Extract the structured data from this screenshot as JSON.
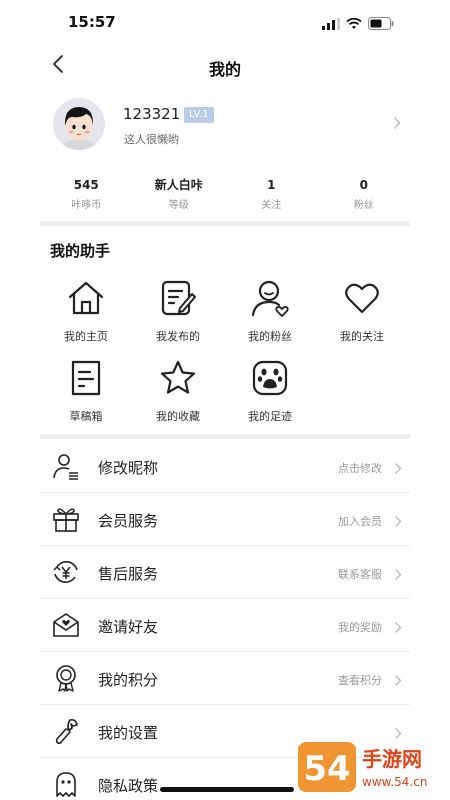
{
  "status_bar": {
    "time": "15:57"
  },
  "nav": {
    "title": "我的"
  },
  "profile": {
    "username": "123321",
    "level": "LV.1",
    "bio": "这人很懒哟"
  },
  "stats": [
    {
      "value": "545",
      "label": "咔哆币"
    },
    {
      "value": "新人白咔",
      "label": "等级"
    },
    {
      "value": "1",
      "label": "关注"
    },
    {
      "value": "0",
      "label": "粉丝"
    }
  ],
  "assistant": {
    "title": "我的助手",
    "items": [
      {
        "label": "我的主页",
        "icon": "home-icon"
      },
      {
        "label": "我发布的",
        "icon": "edit-note-icon"
      },
      {
        "label": "我的粉丝",
        "icon": "fans-icon"
      },
      {
        "label": "我的关注",
        "icon": "heart-icon"
      },
      {
        "label": "草稿箱",
        "icon": "draft-icon"
      },
      {
        "label": "我的收藏",
        "icon": "star-icon"
      },
      {
        "label": "我的足迹",
        "icon": "paw-icon"
      }
    ]
  },
  "menu": [
    {
      "label": "修改昵称",
      "hint": "点击修改",
      "icon": "profile-edit-icon"
    },
    {
      "label": "会员服务",
      "hint": "加入会员",
      "icon": "gift-icon"
    },
    {
      "label": "售后服务",
      "hint": "联系客服",
      "icon": "yen-refresh-icon"
    },
    {
      "label": "邀请好友",
      "hint": "我的奖励",
      "icon": "invite-mail-icon"
    },
    {
      "label": "我的积分",
      "hint": "查看积分",
      "icon": "medal-icon"
    },
    {
      "label": "我的设置",
      "hint": "",
      "icon": "wrench-icon"
    },
    {
      "label": "隐私政策",
      "hint": "",
      "icon": "ghost-icon"
    }
  ],
  "watermark": {
    "text_big": "54",
    "text_a": "手游网",
    "text_b": "www.54.cn"
  }
}
